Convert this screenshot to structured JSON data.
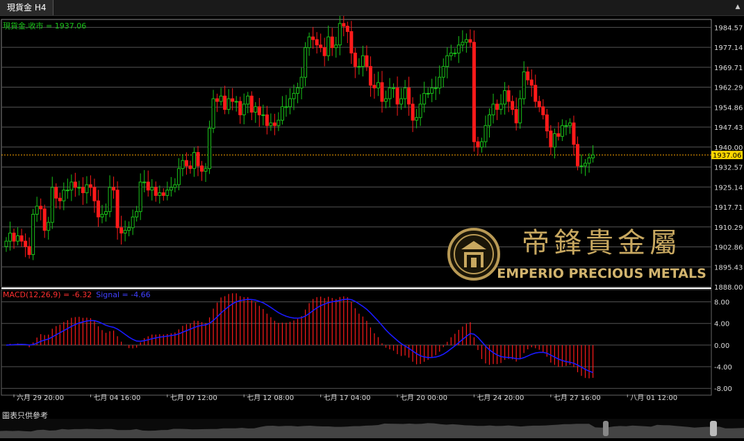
{
  "window": {
    "tab_title": "現貨金 H4"
  },
  "price_label": {
    "name": "現貨金.收市",
    "value": "1937.06"
  },
  "macd_label": {
    "macd_text": "MACD(12,26,9) = -6.32",
    "signal_text": "Signal = -4.66"
  },
  "footer": {
    "note": "圖表只供參考"
  },
  "watermark": {
    "chinese": "帝鋒貴金屬",
    "english": "EMPERIO PRECIOUS METALS"
  },
  "colors": {
    "up": "#19c319",
    "down": "#ff1a1a",
    "signal": "#1a1aff",
    "price_line": "#ffa500",
    "grid": "#555555",
    "text": "#dddddd"
  },
  "chart_data": [
    {
      "type": "candlestick",
      "title": "現貨金 H4",
      "yaxis_ticks": [
        "1984.57",
        "1977.14",
        "1969.71",
        "1962.29",
        "1954.86",
        "1947.43",
        "1940.00",
        "1932.57",
        "1925.14",
        "1917.71",
        "1910.29",
        "1902.86",
        "1895.43",
        "1888.00"
      ],
      "ylim": [
        1888.0,
        1987.5
      ],
      "current_price": "1937.06",
      "x_tick_labels": [
        "六月 29 20:00",
        "七月 04 16:00",
        "七月 07 12:00",
        "七月 12 08:00",
        "七月 17 04:00",
        "七月 20 00:00",
        "七月 24 20:00",
        "七月 27 16:00",
        "八月 01 12:00"
      ],
      "x_tick_index": [
        2,
        22,
        42,
        62,
        82,
        102,
        122,
        142,
        162
      ],
      "closes": [
        1905,
        1908,
        1905,
        1907,
        1905,
        1903,
        1900,
        1915,
        1918,
        1917,
        1909,
        1912,
        1925,
        1921,
        1920,
        1924,
        1924,
        1927,
        1925,
        1925,
        1923,
        1926,
        1925,
        1920,
        1914,
        1915,
        1916,
        1925,
        1924,
        1910,
        1908,
        1909,
        1910,
        1914,
        1916,
        1927,
        1927,
        1924,
        1925,
        1922,
        1923,
        1922,
        1924,
        1925,
        1926,
        1932,
        1935,
        1933,
        1932,
        1938,
        1933,
        1931,
        1932,
        1947,
        1958,
        1957,
        1959,
        1954,
        1958,
        1957,
        1957,
        1952,
        1956,
        1959,
        1953,
        1955,
        1952,
        1952,
        1948,
        1949,
        1948,
        1950,
        1955,
        1955,
        1958,
        1960,
        1962,
        1966,
        1977,
        1981,
        1980,
        1978,
        1977,
        1974,
        1981,
        1977,
        1978,
        1986,
        1985,
        1983,
        1975,
        1970,
        1970,
        1974,
        1970,
        1963,
        1962,
        1964,
        1957,
        1958,
        1962,
        1962,
        1956,
        1958,
        1962,
        1956,
        1950,
        1951,
        1956,
        1960,
        1960,
        1962,
        1962,
        1966,
        1970,
        1974,
        1975,
        1975,
        1978,
        1979,
        1980,
        1979,
        1942,
        1940,
        1942,
        1948,
        1952,
        1956,
        1954,
        1956,
        1961,
        1957,
        1954,
        1949,
        1958,
        1968,
        1965,
        1963,
        1957,
        1955,
        1952,
        1946,
        1940,
        1945,
        1944,
        1948,
        1948,
        1949,
        1941,
        1933,
        1933,
        1934,
        1936,
        1937.06
      ],
      "macd_panel": {
        "yaxis_ticks": [
          "8.00",
          "4.00",
          "0.00",
          "-4.00",
          "-8.00"
        ],
        "ylim": [
          -9.0,
          10.0
        ],
        "macd_last": -6.32,
        "signal_last": -4.66
      }
    }
  ]
}
